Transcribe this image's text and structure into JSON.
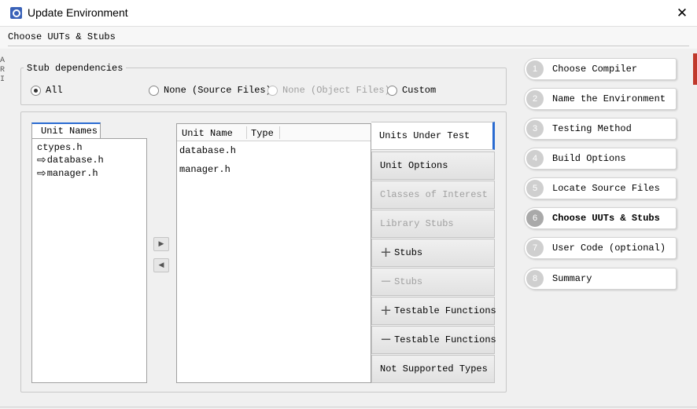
{
  "window": {
    "title": "Update Environment",
    "close_glyph": "✕"
  },
  "header": {
    "label": "Choose UUTs & Stubs"
  },
  "edge": {
    "left_fragment": "A\nR\nI"
  },
  "stub_dependencies": {
    "title": "Stub dependencies",
    "options": [
      {
        "label": "All",
        "checked": true,
        "enabled": true
      },
      {
        "label": "None (Source Files)",
        "checked": false,
        "enabled": true
      },
      {
        "label": "None (Object Files)",
        "checked": false,
        "enabled": false
      },
      {
        "label": "Custom",
        "checked": false,
        "enabled": true
      }
    ]
  },
  "unit_names": {
    "tab_label": "Unit Names",
    "items": [
      {
        "label": "ctypes.h",
        "icon": ""
      },
      {
        "label": "database.h",
        "icon": "⇨"
      },
      {
        "label": "manager.h",
        "icon": "⇨"
      }
    ]
  },
  "move_buttons": {
    "add_glyph": "▶",
    "remove_glyph": "◀"
  },
  "uut_table": {
    "columns": [
      "Unit Name",
      "Type"
    ],
    "rows": [
      {
        "name": "database.h",
        "type": ""
      },
      {
        "name": "manager.h",
        "type": ""
      }
    ]
  },
  "side_tabs": [
    {
      "label": "Units Under Test",
      "symbol": "",
      "state": "active"
    },
    {
      "label": "Unit Options",
      "symbol": "",
      "state": "enabled"
    },
    {
      "label": "Classes of Interest",
      "symbol": "",
      "state": "disabled"
    },
    {
      "label": "Library Stubs",
      "symbol": "",
      "state": "disabled"
    },
    {
      "label": "Stubs",
      "symbol": "+",
      "state": "enabled"
    },
    {
      "label": "Stubs",
      "symbol": "−",
      "state": "disabled"
    },
    {
      "label": "Testable Functions",
      "symbol": "+",
      "state": "enabled"
    },
    {
      "label": "Testable Functions",
      "symbol": "−",
      "state": "enabled"
    },
    {
      "label": "Not Supported Types",
      "symbol": "",
      "state": "enabled"
    }
  ],
  "steps": [
    {
      "num": "1",
      "label": "Choose Compiler",
      "current": false
    },
    {
      "num": "2",
      "label": "Name the Environment",
      "current": false
    },
    {
      "num": "3",
      "label": "Testing Method",
      "current": false
    },
    {
      "num": "4",
      "label": "Build Options",
      "current": false
    },
    {
      "num": "5",
      "label": "Locate Source Files",
      "current": false
    },
    {
      "num": "6",
      "label": "Choose UUTs & Stubs",
      "current": true
    },
    {
      "num": "7",
      "label": "User Code (optional)",
      "current": false
    },
    {
      "num": "8",
      "label": "Summary",
      "current": false
    }
  ],
  "colors": {
    "accent": "#2a6bd1",
    "edge_red": "#c0392b"
  }
}
